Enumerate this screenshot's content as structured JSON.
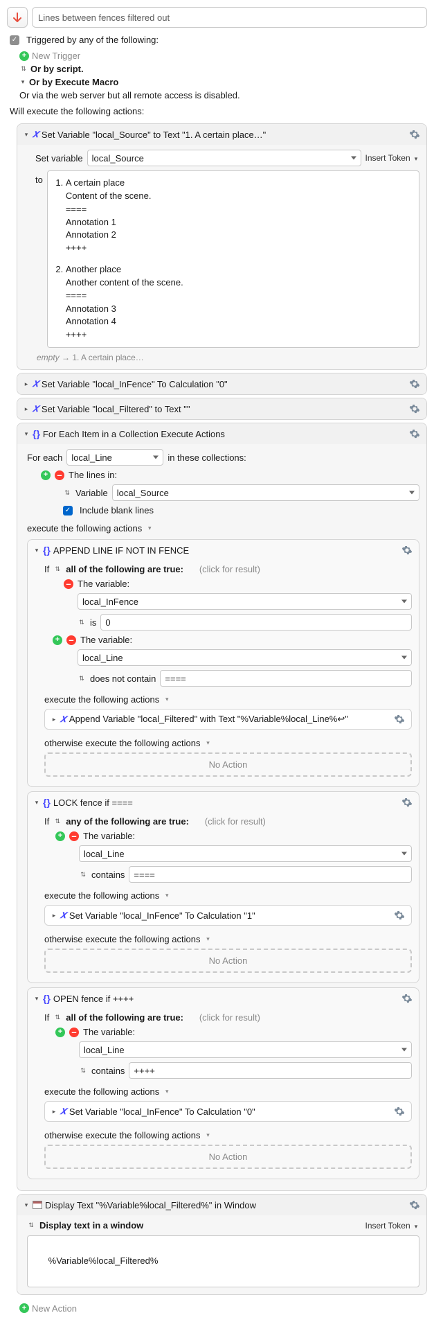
{
  "macro": {
    "title": "Lines between fences filtered out",
    "triggered_label": "Triggered by any of the following:",
    "new_trigger": "New Trigger",
    "or_by_script": "Or by script.",
    "or_by_execute_macro": "Or by Execute Macro",
    "or_via_web": "Or via the web server but all remote access is disabled.",
    "will_execute": "Will execute the following actions:",
    "new_action": "New Action"
  },
  "common": {
    "execute_following": "execute the following actions",
    "otherwise_execute": "otherwise execute the following actions",
    "no_action": "No Action",
    "click_for_result": "(click for result)",
    "the_variable": "The variable:",
    "insert_token": "Insert Token"
  },
  "action_setvar_source": {
    "title": "Set Variable \"local_Source\" to Text \"1. A certain place…\"",
    "set_variable_label": "Set variable",
    "variable_name": "local_Source",
    "to_label": "to",
    "list": [
      {
        "title": "A certain place",
        "lines": [
          "Content of the scene.",
          "====",
          "Annotation 1",
          "Annotation 2",
          "++++"
        ]
      },
      {
        "title": "Another place",
        "lines": [
          "Another content of the scene.",
          "====",
          "Annotation 3",
          "Annotation 4",
          "++++"
        ]
      }
    ],
    "empty_label": "empty",
    "empty_hint": "1. A certain place…"
  },
  "action_setvar_infence": {
    "title": "Set Variable \"local_InFence\" To Calculation \"0\""
  },
  "action_setvar_filtered": {
    "title": "Set Variable \"local_Filtered\" to Text \"\""
  },
  "action_foreach": {
    "title": "For Each Item in a Collection Execute Actions",
    "for_each": "For each",
    "var": "local_Line",
    "in_collections": "in these collections:",
    "lines_in": "The lines in:",
    "variable_label": "Variable",
    "source_var": "local_Source",
    "include_blank": "Include blank lines"
  },
  "if_append": {
    "title": "APPEND LINE IF NOT IN FENCE",
    "if_cond": "all of the following are true:",
    "cond1_var": "local_InFence",
    "cond1_op": "is",
    "cond1_val": "0",
    "cond2_var": "local_Line",
    "cond2_op": "does not contain",
    "cond2_val": "====",
    "sub_action": "Append Variable \"local_Filtered\" with Text \"%Variable%local_Line%↩\""
  },
  "if_lock": {
    "title": "LOCK fence if ====",
    "if_cond": "any of the following are true:",
    "cond_var": "local_Line",
    "cond_op": "contains",
    "cond_val": "====",
    "sub_action": "Set Variable \"local_InFence\" To Calculation \"1\""
  },
  "if_open": {
    "title": "OPEN fence if ++++",
    "if_cond": "all of the following are true:",
    "cond_var": "local_Line",
    "cond_op": "contains",
    "cond_val": "++++",
    "sub_action": "Set Variable \"local_InFence\" To Calculation \"0\""
  },
  "action_display": {
    "title": "Display Text \"%Variable%local_Filtered%\" in Window",
    "display_mode": "Display text in a window",
    "text": "%Variable%local_Filtered%"
  }
}
